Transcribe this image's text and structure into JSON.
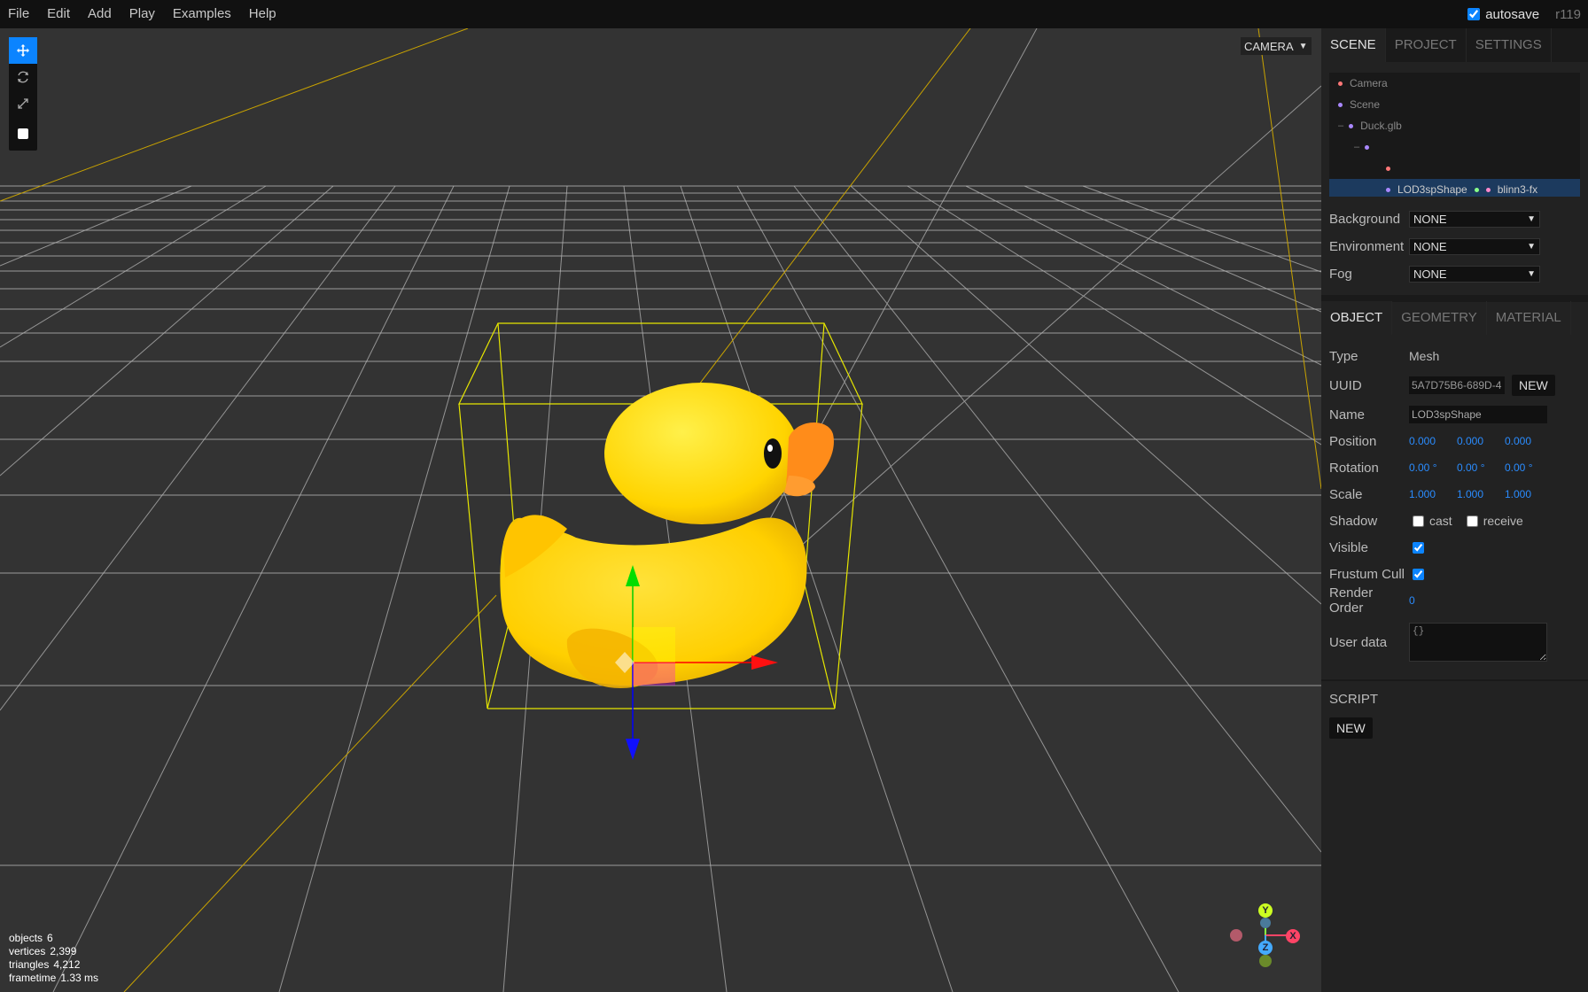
{
  "menubar": {
    "items": [
      "File",
      "Edit",
      "Add",
      "Play",
      "Examples",
      "Help"
    ],
    "autosave_label": "autosave",
    "autosave_checked": true,
    "revision": "r119"
  },
  "viewport": {
    "camera": "CAMERA",
    "info": {
      "objects_label": "objects",
      "objects": "6",
      "vertices_label": "vertices",
      "vertices": "2,399",
      "triangles_label": "triangles",
      "triangles": "4,212",
      "frametime_label": "frametime",
      "frametime": "1.33 ms"
    },
    "axis_labels": {
      "x": "X",
      "y": "Y",
      "z": "Z"
    },
    "colors": {
      "selection_box": "#ffff00",
      "grid": "#888888",
      "duck": "#ffd500",
      "beak": "#ff8c1a",
      "accent": "#0b84ff"
    }
  },
  "toolbar": {
    "tools": [
      "translate-icon",
      "rotate-icon",
      "scale-icon",
      "local-toggle"
    ]
  },
  "sidebar": {
    "tabs": [
      "SCENE",
      "PROJECT",
      "SETTINGS"
    ],
    "outliner": {
      "camera": "Camera",
      "scene": "Scene",
      "duck": "Duck.glb",
      "mesh": "LOD3spShape",
      "material": "blinn3-fx"
    },
    "scene_props": {
      "background_label": "Background",
      "background": "NONE",
      "environment_label": "Environment",
      "environment": "NONE",
      "fog_label": "Fog",
      "fog": "NONE"
    },
    "object_tabs": [
      "OBJECT",
      "GEOMETRY",
      "MATERIAL"
    ],
    "object": {
      "type_label": "Type",
      "type": "Mesh",
      "uuid_label": "UUID",
      "uuid": "5A7D75B6-689D-4",
      "new_label": "NEW",
      "name_label": "Name",
      "name": "LOD3spShape",
      "position_label": "Position",
      "position": [
        "0.000",
        "0.000",
        "0.000"
      ],
      "rotation_label": "Rotation",
      "rotation": [
        "0.00 °",
        "0.00 °",
        "0.00 °"
      ],
      "scale_label": "Scale",
      "scale": [
        "1.000",
        "1.000",
        "1.000"
      ],
      "shadow_label": "Shadow",
      "cast_label": "cast",
      "receive_label": "receive",
      "visible_label": "Visible",
      "frustum_label": "Frustum Cull",
      "render_order_label": "Render Order",
      "render_order": "0",
      "userdata_label": "User data",
      "userdata": "{}"
    },
    "script": {
      "title": "SCRIPT",
      "new_label": "NEW"
    }
  }
}
